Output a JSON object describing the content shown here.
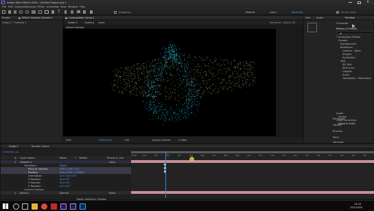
{
  "app": {
    "title": "Adobe After Effects 2020 - Untitled Project.aep *"
  },
  "menu": [
    "File",
    "Edit",
    "Composition",
    "Layer",
    "Effect",
    "Animation",
    "View",
    "Window",
    "Help"
  ],
  "toolbar": {
    "snapping_label": "Snapping",
    "default_label": "Default",
    "learn_label": "Learn",
    "standard_label": "Standard",
    "search_placeholder": "Search Help"
  },
  "project_panel": {
    "tab": "Project",
    "effect_controls_tab": "Effect Controls Camera 1",
    "camera_label": "Comp 1 • Camera 1"
  },
  "comp_panel": {
    "tab": "Composition Comp 1",
    "sub_tabs": [
      "Comp 1",
      "Camera",
      "Layer"
    ],
    "active_camera": "Active Camera",
    "renderer": "Renderer: Classic 3D",
    "zoom": "50%",
    "timecode": "0;00;02;11",
    "resolution": "Full",
    "view": "Active Camera",
    "views": "1 View"
  },
  "right_panel": {
    "tabs": [
      "Info",
      "Audio"
    ],
    "preview_tab": "Preview",
    "align_tab": "Align",
    "effects_tab": "Effects & Presets",
    "effects_search": "st",
    "character_tab": "Character",
    "paragraph_tab": "Paragraph",
    "tracker_tab": "Tracker",
    "brushes_tab": "Brushes",
    "paint_tab": "Paint",
    "libraries_tab": "Libraries",
    "tree": [
      "* Animation Presets",
      "Presets",
      "Backgrounds",
      "Behaviors",
      "Camera - Basic",
      "Shapes",
      "Synthetics",
      "Text",
      "3D Text",
      "Multi-Line",
      "Organic",
      "Scale",
      "Transitions - Movement",
      "Audio",
      "Color Correction",
      "Noise & Grain",
      "Stylize"
    ]
  },
  "timeline": {
    "tab_comp": "Comp 1",
    "tab_render": "Render Queue",
    "timecode": "0;00;02;11",
    "columns": [
      "#",
      "Layer Name",
      "Mode",
      "T",
      "TrkMat",
      "Parent & Link"
    ],
    "layers": [
      {
        "index": "1",
        "name": "Camera 1",
        "parent": "None"
      },
      {
        "name": "Transform",
        "value": "Reset"
      },
      {
        "name": "Point of Interest",
        "value": "960.0,540.0,0.0"
      },
      {
        "name": "Position",
        "value": "960.0,540.0,-2666.7"
      },
      {
        "name": "Orientation",
        "value": "0.0°,0.0°,0.0°"
      },
      {
        "name": "X Rotation",
        "value": "0x+0.0°"
      },
      {
        "name": "Y Rotation",
        "value": "0x+0.0°"
      },
      {
        "name": "Z Rotation",
        "value": "0x+0.0°"
      },
      {
        "name": "Camera Options",
        "value": ""
      },
      {
        "index": "2",
        "name": "[Black]",
        "mode": "Normal",
        "parent": "None"
      }
    ],
    "ruler": [
      "0:00s",
      "01s",
      "02s",
      "03s",
      "04s",
      "05s",
      "06s",
      "07s",
      "08s",
      "09s",
      "10s",
      "11s",
      "12s",
      "13s",
      "14s",
      "15s",
      "16s",
      "17s",
      "18s",
      "19s",
      "20s"
    ],
    "footer": "Toggle Switches / Modes"
  },
  "taskbar": {
    "time": "14:25",
    "date": "15/1/2020"
  },
  "colors": {
    "accent": "#2d8ceb",
    "particles_a": "#28b6d6",
    "particles_b": "#d2d68c",
    "layer_bar": "#c9909a"
  }
}
